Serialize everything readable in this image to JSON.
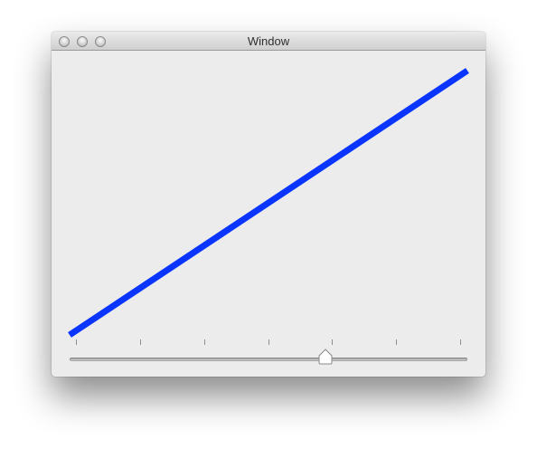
{
  "window": {
    "title": "Window"
  },
  "slider": {
    "value": 0.65,
    "tick_count": 7
  },
  "line": {
    "color": "#0a35ff"
  }
}
